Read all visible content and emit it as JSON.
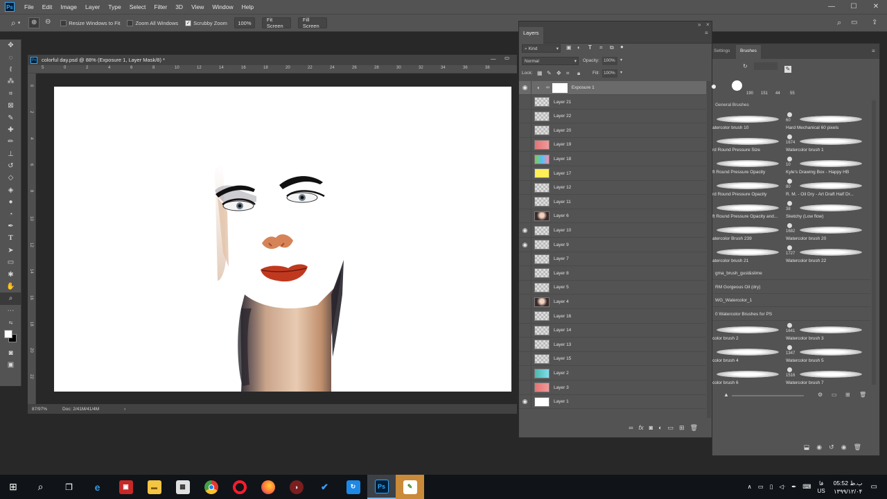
{
  "app": {
    "menu": [
      "File",
      "Edit",
      "Image",
      "Layer",
      "Type",
      "Select",
      "Filter",
      "3D",
      "View",
      "Window",
      "Help"
    ],
    "window_controls": [
      "—",
      "☐",
      "✕"
    ]
  },
  "options_bar": {
    "resize_windows": "Resize Windows to Fit",
    "zoom_all": "Zoom All Windows",
    "scrubby_zoom": "Scrubby Zoom",
    "zoom_value": "100%",
    "fit_screen": "Fit Screen",
    "fill_screen": "Fill Screen",
    "checks": {
      "resize": false,
      "zoom_all": false,
      "scrubby": true
    }
  },
  "document": {
    "title": "colorful day.psd @ 88% (Exposure 1, Layer Mask/8) *",
    "ruler_top": [
      "5",
      "0",
      "2",
      "4",
      "6",
      "8",
      "10",
      "12",
      "14",
      "16",
      "18",
      "20",
      "22",
      "24",
      "26",
      "28",
      "30",
      "32",
      "34",
      "36",
      "38"
    ],
    "ruler_left": [
      "0",
      "2",
      "4",
      "6",
      "8",
      "10",
      "12",
      "14",
      "16",
      "18",
      "20",
      "22"
    ],
    "status_zoom": "87/97%",
    "status_doc": "Doc: 2/41M/41/4M"
  },
  "layers_panel": {
    "tab": "Layers",
    "filter": "Kind",
    "blend_mode": "Normal",
    "opacity_label": "Opacity:",
    "opacity": "100%",
    "lock_label": "Lock:",
    "fill_label": "Fill:",
    "fill": "100%",
    "layers": [
      {
        "name": "Exposure 1",
        "visible": true,
        "thumb": "adjust",
        "selected": true
      },
      {
        "name": "Layer 21",
        "visible": false,
        "thumb": "empty"
      },
      {
        "name": "Layer 22",
        "visible": false,
        "thumb": "empty"
      },
      {
        "name": "Layer 20",
        "visible": false,
        "thumb": "empty"
      },
      {
        "name": "Layer 19",
        "visible": false,
        "thumb": "red"
      },
      {
        "name": "Layer 18",
        "visible": false,
        "thumb": "multi"
      },
      {
        "name": "Layer 17",
        "visible": false,
        "thumb": "yellow"
      },
      {
        "name": "Layer 12",
        "visible": false,
        "thumb": "empty"
      },
      {
        "name": "Layer 11",
        "visible": false,
        "thumb": "empty"
      },
      {
        "name": "Layer 6",
        "visible": false,
        "thumb": "photo"
      },
      {
        "name": "Layer 10",
        "visible": true,
        "thumb": "empty"
      },
      {
        "name": "Layer 9",
        "visible": true,
        "thumb": "empty"
      },
      {
        "name": "Layer 7",
        "visible": false,
        "thumb": "empty"
      },
      {
        "name": "Layer 8",
        "visible": false,
        "thumb": "empty"
      },
      {
        "name": "Layer 5",
        "visible": false,
        "thumb": "empty"
      },
      {
        "name": "Layer 4",
        "visible": false,
        "thumb": "photo"
      },
      {
        "name": "Layer 16",
        "visible": false,
        "thumb": "empty"
      },
      {
        "name": "Layer 14",
        "visible": false,
        "thumb": "empty"
      },
      {
        "name": "Layer 13",
        "visible": false,
        "thumb": "empty"
      },
      {
        "name": "Layer 15",
        "visible": false,
        "thumb": "empty"
      },
      {
        "name": "Layer 2",
        "visible": false,
        "thumb": "teal"
      },
      {
        "name": "Layer 3",
        "visible": false,
        "thumb": "red"
      },
      {
        "name": "Layer 1",
        "visible": true,
        "thumb": "white"
      }
    ]
  },
  "brushes_panel": {
    "tabs": [
      "Settings",
      "Brushes"
    ],
    "preset_sizes": [
      "190",
      "151",
      "44",
      "55"
    ],
    "group_general": "General Brushes",
    "brushes": [
      {
        "left": "atercolor brush 10",
        "right_size": "60",
        "right": "Hard Mechanical 60 pixels"
      },
      {
        "left": "rd Round Pressure Size",
        "right_size": "1674",
        "right": "Watercolor brush 1"
      },
      {
        "left": "ft Round Pressure Opacity",
        "right_size": "10",
        "right": "Kyle's Drawing Box - Happy HB"
      },
      {
        "left": "rd Round Pressure Opacity",
        "right_size": "80",
        "right": "R. M. - Oil Dry - Art Draft Half Dr..."
      },
      {
        "left": "ft Round Pressure Opacity and...",
        "right_size": "38",
        "right": "Sketchy (Low flow)"
      },
      {
        "left": "atercolor Brush 239",
        "right_size": "1682",
        "right": "Watercolor brush 20"
      },
      {
        "left": "atercolor brush 21",
        "right_size": "1727",
        "right": "Watercolor brush 22"
      }
    ],
    "groups": [
      "gma_brush_gust&slime",
      "RM Gorgeous Oil (dry)",
      "WG_Watercolor_1",
      "0 Watercolor Brushes for PS"
    ],
    "brushes2": [
      {
        "left": "color brush 2",
        "right_size": "1641",
        "right": "Watercolor brush 3"
      },
      {
        "left": "color brush 4",
        "right_size": "1347",
        "right": "Watercolor brush 5"
      },
      {
        "left": "color brush 6",
        "right_size": "1516",
        "right": "Watercolor brush 7"
      }
    ]
  },
  "taskbar": {
    "time": "05:52 ب.ظ",
    "date": "۱۳۹۹/۱۲/۰۴",
    "lang": "فا",
    "lang2": "US",
    "colors": {
      "photoshop": "#31a8ff",
      "edge": "#2f9be8",
      "opera": "#ff1b2d",
      "chrome": "#4caf50"
    }
  }
}
